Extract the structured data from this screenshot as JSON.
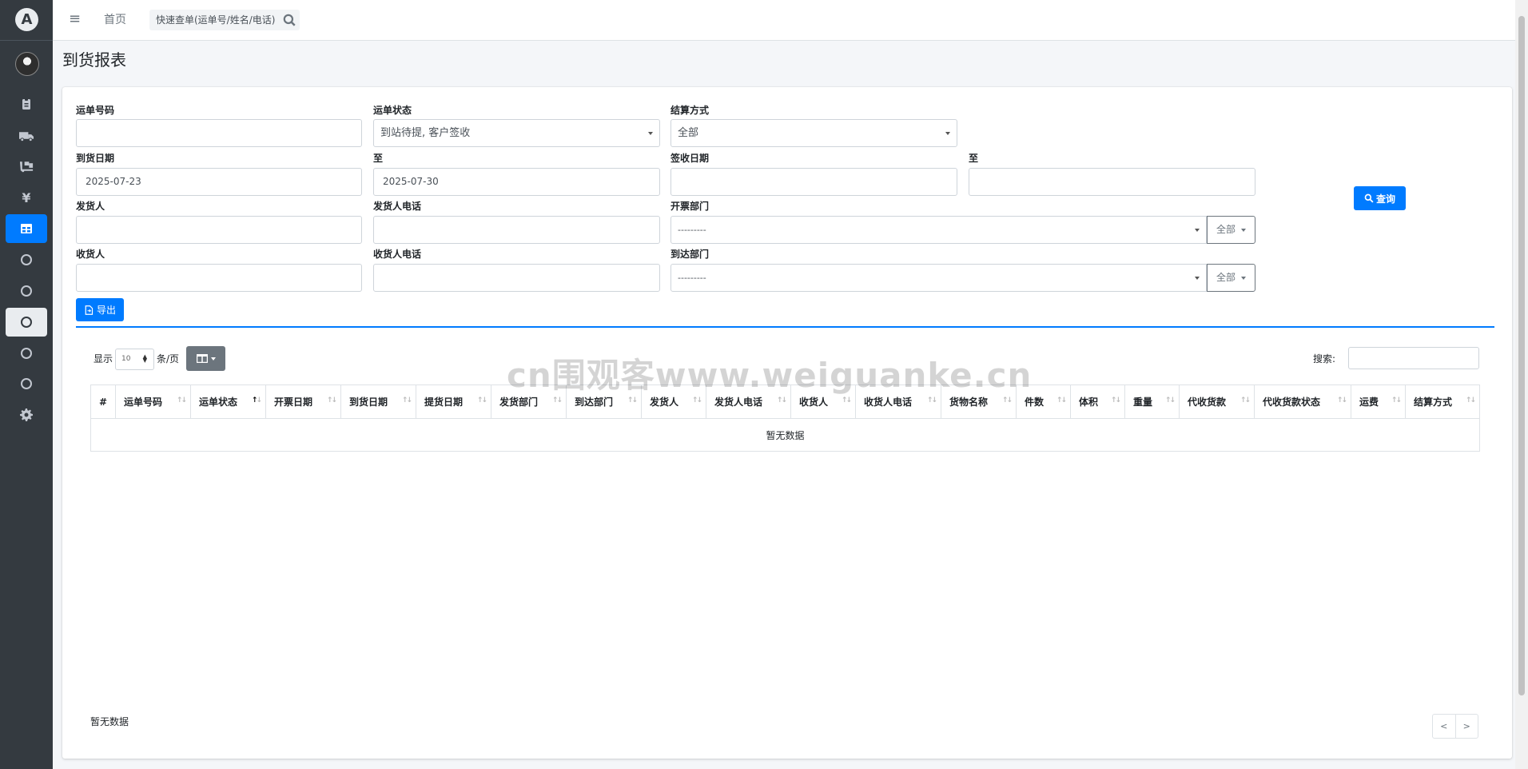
{
  "sidebar": {
    "logo_letter": "A",
    "items": [
      {
        "icon": "clipboard-icon"
      },
      {
        "icon": "truck-icon"
      },
      {
        "icon": "dolly-icon"
      },
      {
        "icon": "yen-icon",
        "glyph": "¥"
      },
      {
        "icon": "table-icon",
        "active": true
      },
      {
        "icon": "circle-icon"
      },
      {
        "icon": "circle-icon"
      },
      {
        "icon": "circle-icon",
        "hover": true
      },
      {
        "icon": "circle-icon"
      },
      {
        "icon": "circle-icon"
      },
      {
        "icon": "gear-icon"
      }
    ]
  },
  "navbar": {
    "home_label": "首页",
    "search_placeholder": "快速查单(运单号/姓名/电话)"
  },
  "page": {
    "title": "到货报表"
  },
  "filters": {
    "waybill_no": {
      "label": "运单号码",
      "value": ""
    },
    "waybill_status": {
      "label": "运单状态",
      "value": "到站待提, 客户签收"
    },
    "settlement": {
      "label": "结算方式",
      "value": "全部"
    },
    "arrival_date": {
      "label": "到货日期",
      "from": "2025-07-23",
      "to_label": "至",
      "to": "2025-07-30"
    },
    "sign_date": {
      "label": "签收日期",
      "from": "",
      "to_label": "至",
      "to": ""
    },
    "shipper": {
      "label": "发货人",
      "value": ""
    },
    "shipper_phone": {
      "label": "发货人电话",
      "value": ""
    },
    "issue_dept": {
      "label": "开票部门",
      "value": "---------",
      "scope": "全部"
    },
    "consignee": {
      "label": "收货人",
      "value": ""
    },
    "consignee_phone": {
      "label": "收货人电话",
      "value": ""
    },
    "arrival_dept": {
      "label": "到达部门",
      "value": "---------",
      "scope": "全部"
    },
    "query_label": "查询",
    "export_label": "导出"
  },
  "table": {
    "show_label": "显示",
    "page_length": "10",
    "per_page_label": "条/页",
    "search_label": "搜索:",
    "columns": [
      "#",
      "运单号码",
      "运单状态",
      "开票日期",
      "到货日期",
      "提货日期",
      "发货部门",
      "到达部门",
      "发货人",
      "发货人电话",
      "收货人",
      "收货人电话",
      "货物名称",
      "件数",
      "体积",
      "重量",
      "代收货款",
      "代收货款状态",
      "运费",
      "结算方式"
    ],
    "sorted_column": "运单状态",
    "empty_text": "暂无数据",
    "info_text": "暂无数据",
    "pager_prev": "<",
    "pager_next": ">"
  },
  "watermark": "cn围观客www.weiguanke.cn",
  "colors": {
    "primary": "#007bff",
    "sidebar": "#343a40",
    "secondary": "#6c757d"
  }
}
